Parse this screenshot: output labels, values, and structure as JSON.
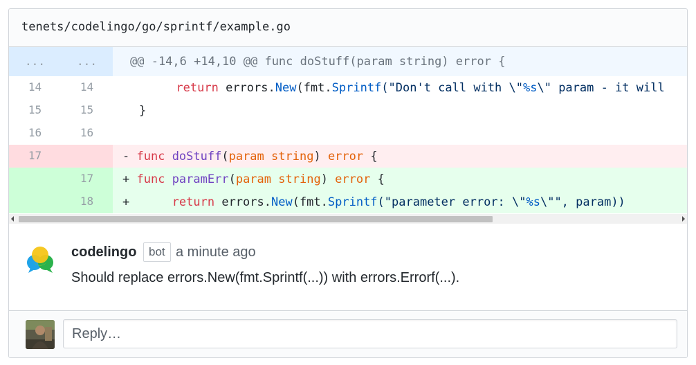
{
  "file": {
    "path": "tenets/codelingo/go/sprintf/example.go"
  },
  "diff": {
    "hunk": {
      "left": "...",
      "right": "...",
      "text": "@@ -14,6 +14,10 @@ func doStuff(param string) error {"
    },
    "lines": [
      {
        "type": "context",
        "old": "14",
        "new": "14",
        "prefix": "      ",
        "kw": "return",
        "a": " errors.",
        "fn1": "New",
        "b": "(fmt.",
        "fn2": "Sprintf",
        "c": "(\"Don't call with \\\"",
        "fmt": "%s",
        "d": "\\\" param - it will"
      },
      {
        "type": "context",
        "old": "15",
        "new": "15",
        "text": "}"
      },
      {
        "type": "context",
        "old": "16",
        "new": "16",
        "text": ""
      },
      {
        "type": "del",
        "old": "17",
        "new": "",
        "sign": "- ",
        "kw": "func",
        "name": "doStuff",
        "p1": "(",
        "param": "param",
        "sp": " ",
        "typ": "string",
        "p2": ") ",
        "ret": "error",
        "tail": " {"
      },
      {
        "type": "add",
        "old": "",
        "new": "17",
        "sign": "+ ",
        "kw": "func",
        "name": "paramErr",
        "p1": "(",
        "param": "param",
        "sp": " ",
        "typ": "string",
        "p2": ") ",
        "ret": "error",
        "tail": " {"
      },
      {
        "type": "add",
        "old": "",
        "new": "18",
        "sign": "+",
        "prefix": "      ",
        "kw": "return",
        "a": " errors.",
        "fn1": "New",
        "b": "(fmt.",
        "fn2": "Sprintf",
        "c": "(\"parameter error: \\\"",
        "fmt": "%s",
        "d": "\\\"\", param))"
      }
    ]
  },
  "comment": {
    "author": "codelingo",
    "badge": "bot",
    "time": "a minute ago",
    "body": "Should replace errors.New(fmt.Sprintf(...)) with errors.Errorf(...)."
  },
  "reply": {
    "placeholder": "Reply…"
  },
  "colors": {
    "keyword": "#d73a49",
    "function": "#6f42c1",
    "string": "#032f62",
    "entity": "#005cc5",
    "param": "#e36209"
  },
  "icons": {
    "bot_avatar": "codelingo-logo-icon",
    "user_avatar": "user-avatar-icon"
  }
}
